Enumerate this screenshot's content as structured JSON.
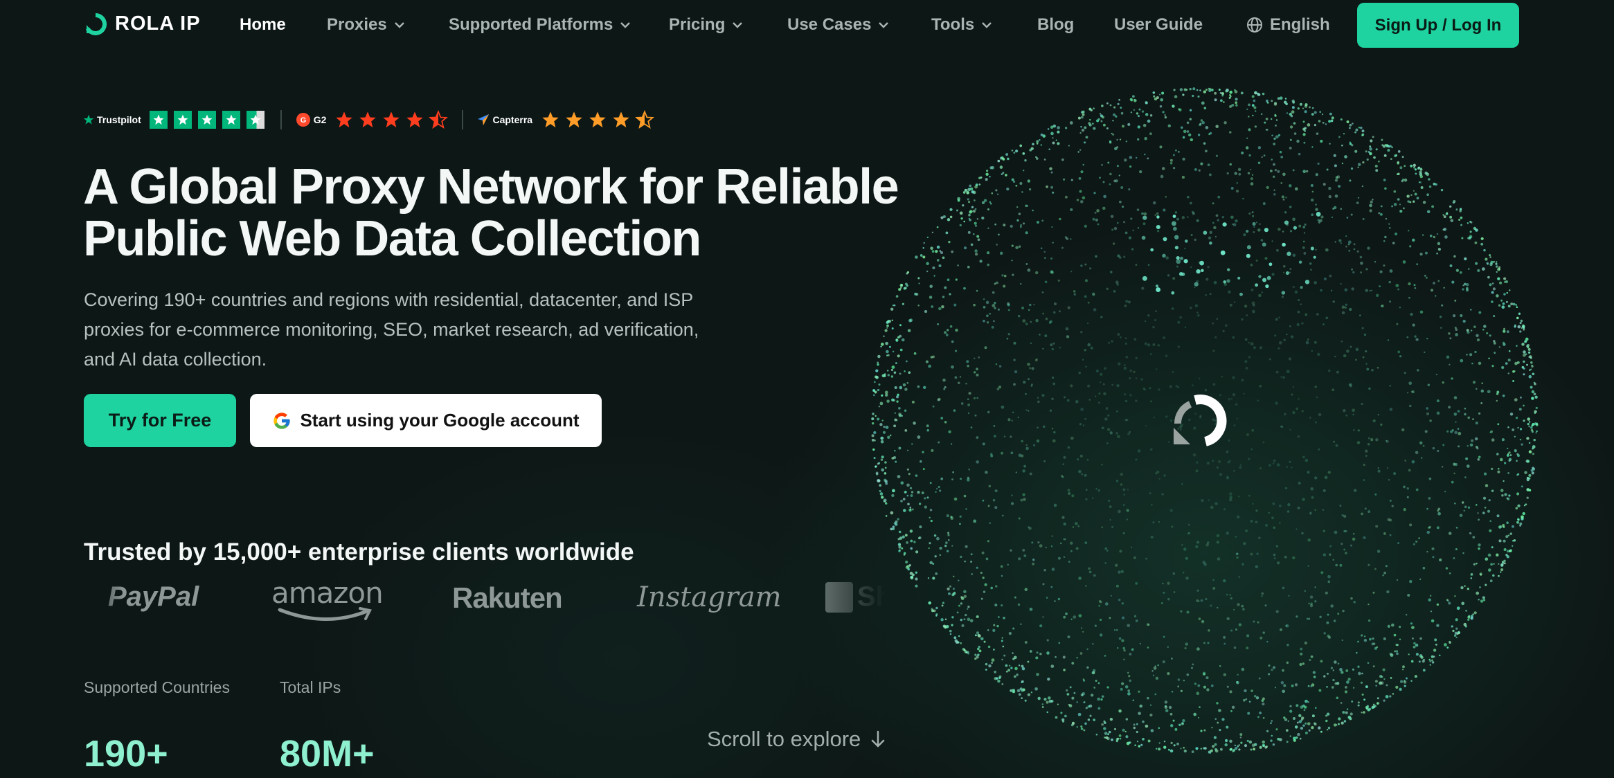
{
  "brand": {
    "name": "ROLA IP",
    "accent": "#1fd3a0"
  },
  "nav": {
    "items": [
      {
        "label": "Home",
        "active": true,
        "dropdown": false
      },
      {
        "label": "Proxies",
        "dropdown": true
      },
      {
        "label": "Supported Platforms",
        "dropdown": true
      },
      {
        "label": "Pricing",
        "dropdown": true
      },
      {
        "label": "Use Cases",
        "dropdown": true
      },
      {
        "label": "Tools",
        "dropdown": true
      },
      {
        "label": "Blog",
        "dropdown": false
      },
      {
        "label": "User Guide",
        "dropdown": false
      }
    ],
    "language": "English",
    "signup_label": "Sign Up / Log In"
  },
  "ratings": {
    "trustpilot": {
      "label": "Trustpilot",
      "stars": 4.5
    },
    "g2": {
      "label": "G2",
      "stars": 4.5
    },
    "capterra": {
      "label": "Capterra",
      "stars": 4.5
    }
  },
  "hero": {
    "title_line1": "A Global Proxy Network for Reliable",
    "title_line2": "Public Web Data Collection",
    "subtitle_line1": "Covering 190+ countries and regions with residential, datacenter, and ISP",
    "subtitle_line2": "proxies for e-commerce monitoring, SEO, market research, ad verification,",
    "subtitle_line3": "and AI data collection.",
    "cta_primary": "Try for Free",
    "cta_google": "Start using your Google account"
  },
  "trusted": {
    "title": "Trusted by 15,000+ enterprise clients worldwide",
    "brands": [
      "PayPal",
      "amazon",
      "Rakuten",
      "Instagram",
      "Shopify"
    ]
  },
  "stats": [
    {
      "label": "Supported Countries",
      "value": "190+"
    },
    {
      "label": "Total IPs",
      "value": "80M+"
    }
  ],
  "scroll_hint": "Scroll to explore"
}
